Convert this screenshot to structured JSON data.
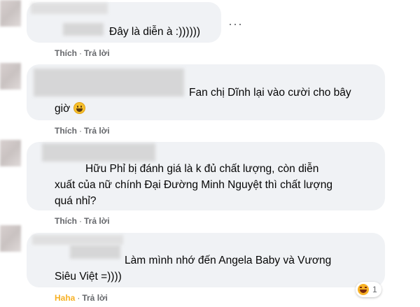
{
  "comments": [
    {
      "text": "Đây là diễn à :))))))",
      "like": "Thích",
      "reply": "Trả lời",
      "more": "···"
    },
    {
      "text_line1": "Fan chị Dĩnh lại vào cười cho bây",
      "text_line2": "giờ",
      "emoji": "grinning-face",
      "like": "Thích",
      "reply": "Trả lời"
    },
    {
      "text_line1": "Hữu Phỉ bị đánh giá là k đủ chất lượng, còn diễn",
      "text_line2": "xuất của nữ chính Đại Đường Minh Nguyệt thì chất lượng",
      "text_line3": "quá nhỉ?",
      "like": "Thích",
      "reply": "Trả lời"
    },
    {
      "text_line1": "Làm mình nhớ đến Angela Baby và Vương",
      "text_line2": "Siêu Việt =))))",
      "reaction_label": "Haha",
      "reply": "Trả lời",
      "reaction_count": "1",
      "reaction_icon": "haha-icon"
    }
  ],
  "colors": {
    "bubble": "#f0f2f5",
    "action_text": "#65676b",
    "haha": "#f7b125"
  }
}
